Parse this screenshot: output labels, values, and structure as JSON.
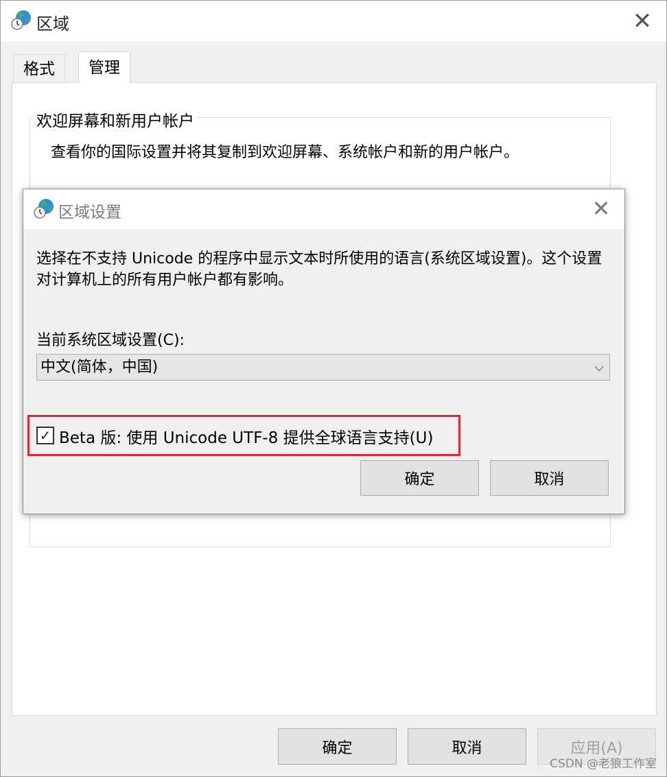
{
  "window": {
    "title": "区域",
    "close_glyph": "✕",
    "tabs": [
      {
        "label": "格式",
        "active": false
      },
      {
        "label": "管理",
        "active": true
      }
    ],
    "group": {
      "label": "欢迎屏幕和新用户帐户",
      "description": "查看你的国际设置并将其复制到欢迎屏幕、系统帐户和新的用户帐户。"
    },
    "buttons": {
      "ok": "确定",
      "cancel": "取消",
      "apply": "应用(A)"
    }
  },
  "dialog": {
    "title": "区域设置",
    "close_glyph": "✕",
    "description": "选择在不支持 Unicode 的程序中显示文本时所使用的语言(系统区域设置)。这个设置对计算机上的所有用户帐户都有影响。",
    "select_label": "当前系统区域设置(C):",
    "select_value": "中文(简体，中国)",
    "checkbox_label": "Beta 版: 使用 Unicode UTF-8 提供全球语言支持(U)",
    "checkbox_checked": true,
    "checkbox_mark": "✓",
    "buttons": {
      "ok": "确定",
      "cancel": "取消"
    },
    "highlight_color": "#e0262f"
  },
  "watermark": "CSDN @老狼工作室",
  "icons": {
    "title_icon": "region-globe-clock-icon",
    "chevron": "⌵"
  }
}
